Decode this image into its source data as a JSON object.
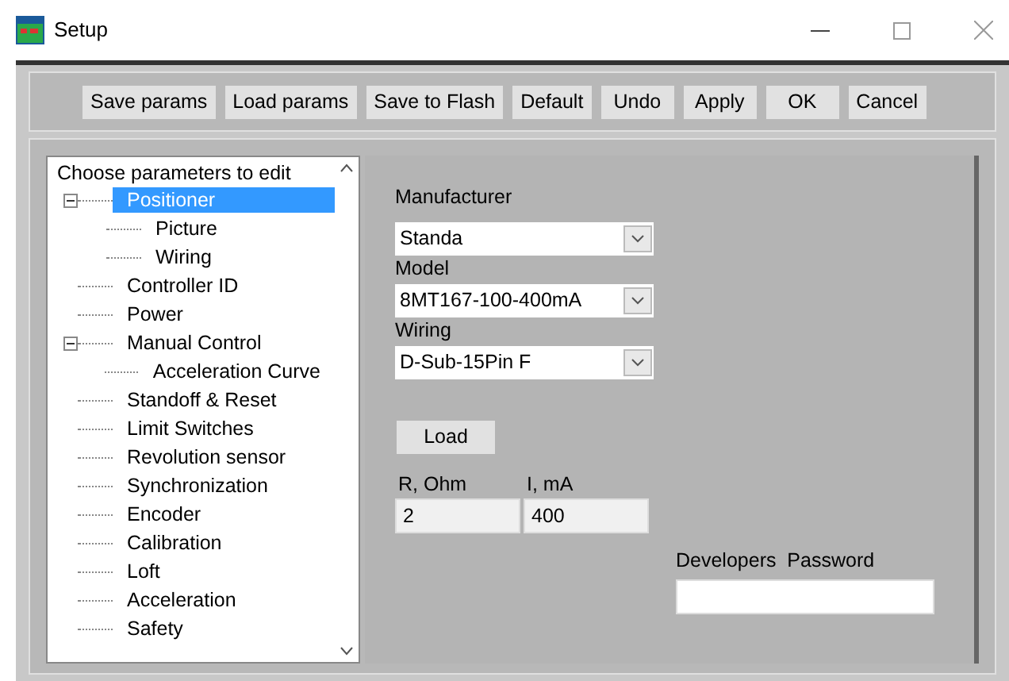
{
  "window": {
    "title": "Setup"
  },
  "toolbar": [
    "Save params",
    "Load params",
    "Save to Flash",
    "Default",
    "Undo",
    "Apply",
    "OK",
    "Cancel"
  ],
  "tree": {
    "header": "Choose parameters to edit",
    "items": [
      {
        "label": "Positioner",
        "selected": true,
        "expanded": true,
        "children": [
          {
            "label": "Picture",
            "selected": false
          },
          {
            "label": "Wiring",
            "selected": false
          }
        ]
      },
      {
        "label": "Controller ID",
        "selected": false
      },
      {
        "label": "Power",
        "selected": false
      },
      {
        "label": "Manual Control",
        "selected": false,
        "expanded": true,
        "children": [
          {
            "label": "Acceleration Curve",
            "selected": false
          }
        ]
      },
      {
        "label": "Standoff & Reset",
        "selected": false
      },
      {
        "label": "Limit Switches",
        "selected": false
      },
      {
        "label": "Revolution sensor",
        "selected": false
      },
      {
        "label": "Synchronization",
        "selected": false
      },
      {
        "label": "Encoder",
        "selected": false
      },
      {
        "label": "Calibration",
        "selected": false
      },
      {
        "label": "Loft",
        "selected": false
      },
      {
        "label": "Acceleration",
        "selected": false
      },
      {
        "label": "Safety",
        "selected": false
      }
    ]
  },
  "form": {
    "dropdowns": [
      {
        "label": "Manufacturer",
        "value": "Standa"
      },
      {
        "label": "Model",
        "value": "8MT167-100-400mA"
      },
      {
        "label": "Wiring",
        "value": "D-Sub-15Pin F"
      }
    ],
    "load_button": "Load",
    "fields": [
      {
        "label": "R, Ohm",
        "value": "2"
      },
      {
        "label": "I, mA",
        "value": "400"
      }
    ],
    "password": {
      "label": "Developers  Password"
    }
  }
}
